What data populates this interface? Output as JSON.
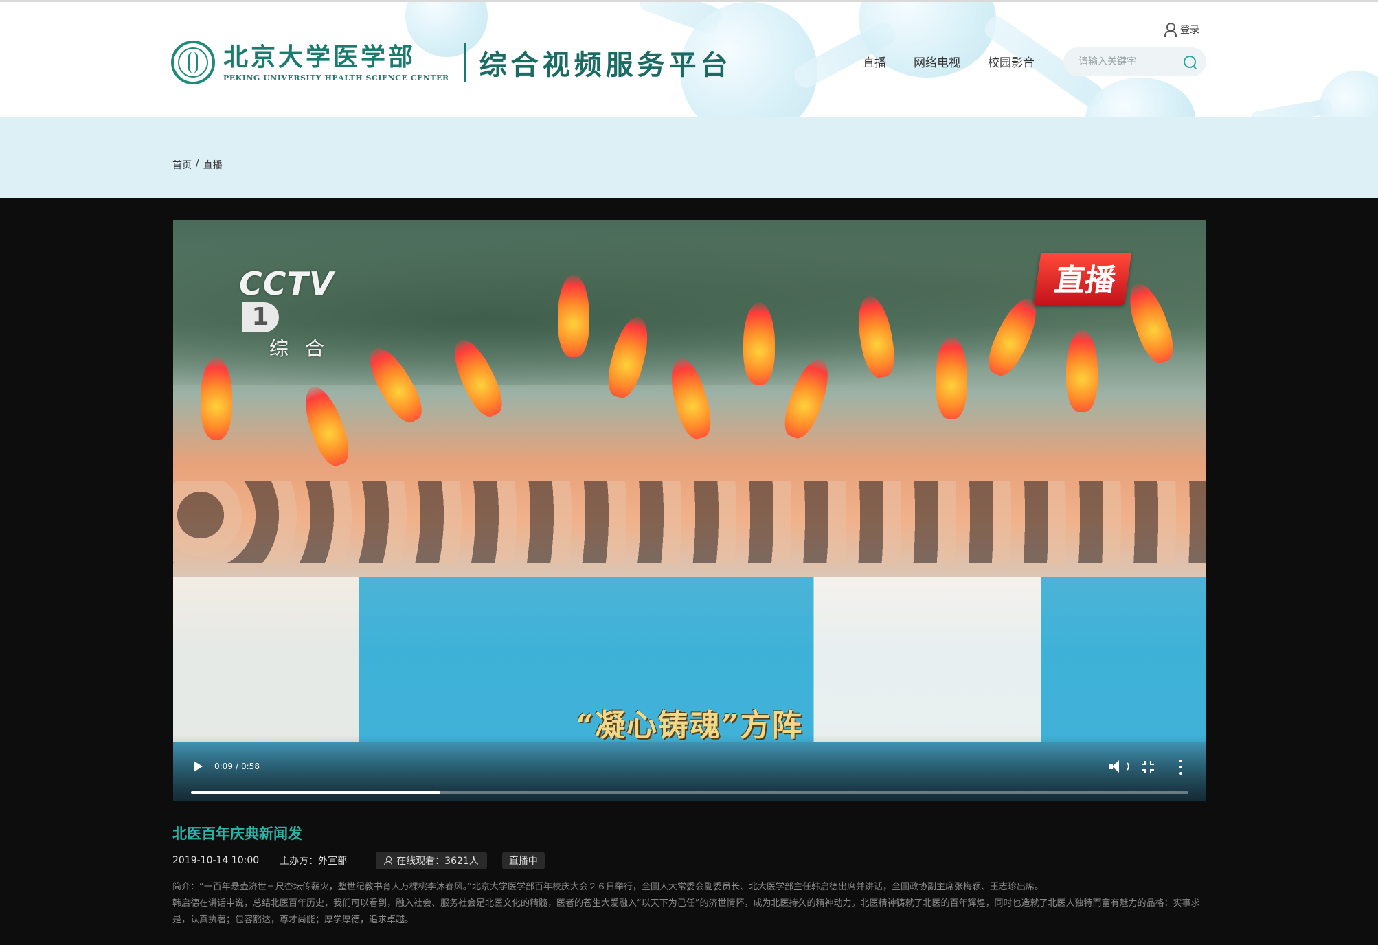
{
  "header": {
    "logo_cn": "北京大学医学部",
    "logo_en": "PEKING UNIVERSITY HEALTH SCIENCE CENTER",
    "platform_title": "综合视频服务平台",
    "nav": [
      {
        "label": "直播"
      },
      {
        "label": "网络电视"
      },
      {
        "label": "校园影音"
      }
    ],
    "search": {
      "placeholder": "请输入关键字",
      "value": ""
    },
    "login_label": "登录"
  },
  "breadcrumb": {
    "home": "首页",
    "separator": "/",
    "current": "直播"
  },
  "player": {
    "channel_logo": "CCTV",
    "channel_number": "1",
    "channel_name": "综合",
    "live_bug": "直播",
    "caption": "“凝心铸魂”方阵",
    "current_time": "0:09",
    "time_separator": "/",
    "duration": "0:58",
    "progress_fraction": 0.25
  },
  "video": {
    "title": "北医百年庆典新闻发",
    "date": "2019-10-14  10:00",
    "host": "主办方：外宣部",
    "viewers": "在线观看：3621人",
    "status": "直播中",
    "intro_line1": "简介：“一百年悬壶济世三尺杏坛传薪火，整世纪教书育人万棵桃李沐春风。”北京大学医学部百年校庆大会２６日举行，全国人大常委会副委员长、北大医学部主任韩启德出席并讲话，全国政协副主席张梅颖、王志珍出席。",
    "intro_line2": "韩启德在讲话中说，总结北医百年历史，我们可以看到，融入社会、服务社会是北医文化的精髓，医者的苍生大爱融入“以天下为己任”的济世情怀，成为北医持久的精神动力。北医精神铸就了北医的百年辉煌，同时也造就了北医人独特而富有魅力的品格：实事求是，认真执著；包容豁达，尊才尚能；厚学厚德，追求卓越。"
  },
  "colors": {
    "brand_green": "#1a7c6f",
    "accent_teal": "#2ab3a6",
    "breadcrumb_band": "#dcf0f5",
    "page_bg": "#0d0d0d"
  }
}
